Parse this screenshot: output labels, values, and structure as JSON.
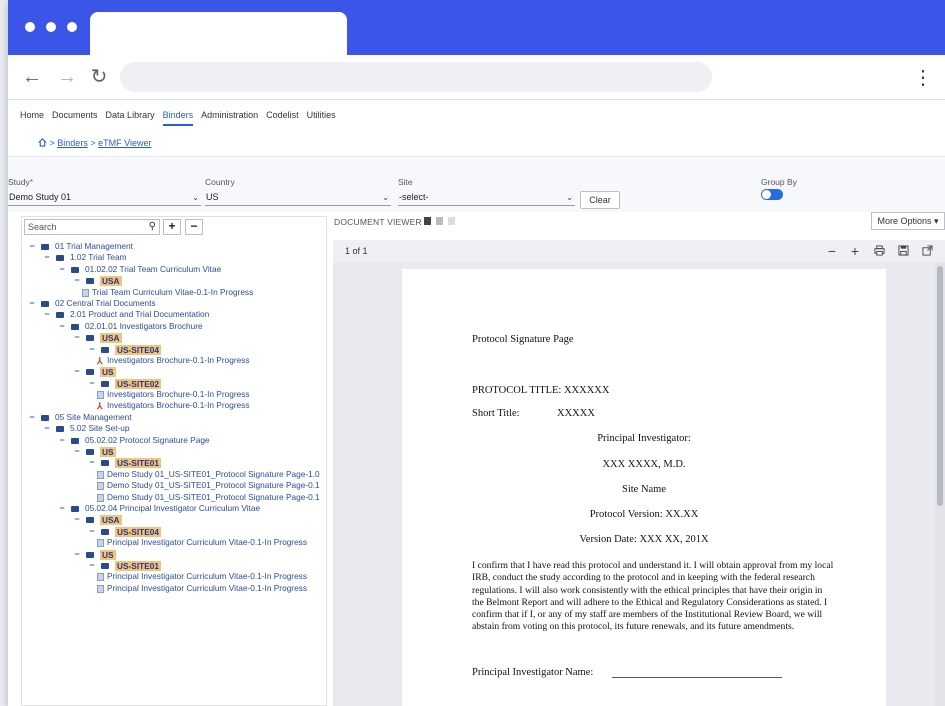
{
  "app": {
    "menu": [
      "Home",
      "Documents",
      "Data Library",
      "Binders",
      "Administration",
      "Codelist",
      "Utilities"
    ],
    "active_menu": "Binders",
    "breadcrumb": {
      "home_icon": "home-icon",
      "sep1": ">",
      "binders": "Binders",
      "sep2": ">",
      "current": "eTMF Viewer"
    }
  },
  "filters": {
    "study": {
      "label": "Study",
      "required_mark": "*",
      "value": "Demo Study 01"
    },
    "country": {
      "label": "Country",
      "value": "US"
    },
    "site": {
      "label": "Site",
      "value": "-select-"
    },
    "clear_label": "Clear",
    "group_by": {
      "label": "Group By",
      "enabled": true
    }
  },
  "tree_panel": {
    "search_placeholder": "Search",
    "add_label": "+",
    "collapse_label": "−",
    "rows": [
      {
        "indent": 0,
        "type": "folder",
        "toggle": "−",
        "label": "01 Trial Management"
      },
      {
        "indent": 1,
        "type": "folder",
        "toggle": "−",
        "label": "1.02 Trial Team"
      },
      {
        "indent": 2,
        "type": "folder",
        "toggle": "−",
        "label": "01.02.02 Trial Team Curriculum Vitae"
      },
      {
        "indent": 3,
        "type": "country",
        "toggle": "−",
        "label": "USA"
      },
      {
        "indent": 4,
        "type": "doc",
        "label": "Trial Team Curriculum Vitae-0.1-In Progress"
      },
      {
        "indent": 0,
        "type": "folder",
        "toggle": "−",
        "label": "02 Central Trial Documents"
      },
      {
        "indent": 1,
        "type": "folder",
        "toggle": "−",
        "label": "2.01 Product and Trial Documentation"
      },
      {
        "indent": 2,
        "type": "folder",
        "toggle": "−",
        "label": "02.01.01 Investigators Brochure"
      },
      {
        "indent": 3,
        "type": "country",
        "toggle": "−",
        "label": "USA"
      },
      {
        "indent": 4,
        "type": "country",
        "toggle": "−",
        "label": "US-SITE04"
      },
      {
        "indent": 5,
        "type": "pdf",
        "label": "Investigators Brochure-0.1-In Progress"
      },
      {
        "indent": 3,
        "type": "country",
        "toggle": "−",
        "label": "US"
      },
      {
        "indent": 4,
        "type": "country",
        "toggle": "−",
        "label": "US-SITE02"
      },
      {
        "indent": 5,
        "type": "doc",
        "label": "Investigators Brochure-0.1-In Progress"
      },
      {
        "indent": 5,
        "type": "pdf",
        "label": "Investigators Brochure-0.1-In Progress"
      },
      {
        "indent": 0,
        "type": "folder",
        "toggle": "−",
        "label": "05 Site Management"
      },
      {
        "indent": 1,
        "type": "folder",
        "toggle": "−",
        "label": "5.02 Site Set-up"
      },
      {
        "indent": 2,
        "type": "folder",
        "toggle": "−",
        "label": "05.02.02 Protocol Signature Page"
      },
      {
        "indent": 3,
        "type": "country",
        "toggle": "−",
        "label": "US"
      },
      {
        "indent": 4,
        "type": "country",
        "toggle": "−",
        "label": "US-SITE01"
      },
      {
        "indent": 5,
        "type": "doc",
        "label": "Demo Study 01_US-SITE01_Protocol Signature Page-1.0"
      },
      {
        "indent": 5,
        "type": "doc",
        "label": "Demo Study 01_US-SITE01_Protocol Signature Page-0.1"
      },
      {
        "indent": 5,
        "type": "doc",
        "label": "Demo Study 01_US-SITE01_Protocol Signature Page-0.1"
      },
      {
        "indent": 2,
        "type": "folder",
        "toggle": "−",
        "label": "05.02.04 Principal Investigator Curriculum Vitae"
      },
      {
        "indent": 3,
        "type": "country",
        "toggle": "−",
        "label": "USA"
      },
      {
        "indent": 4,
        "type": "country",
        "toggle": "−",
        "label": "US-SITE04"
      },
      {
        "indent": 5,
        "type": "doc",
        "label": "Principal Investigator Curriculum Vitae-0.1-In Progress"
      },
      {
        "indent": 3,
        "type": "country",
        "toggle": "−",
        "label": "US"
      },
      {
        "indent": 4,
        "type": "country",
        "toggle": "−",
        "label": "US-SITE01"
      },
      {
        "indent": 5,
        "type": "doc",
        "label": "Principal Investigator Curriculum Vitae-0.1-In Progress"
      },
      {
        "indent": 5,
        "type": "doc",
        "label": "Principal Investigator Curriculum Vitae-0.1-In Progress"
      }
    ]
  },
  "viewer": {
    "title": "DOCUMENT VIEWER",
    "more_options": "More Options ▾",
    "page_count": "1 of 1",
    "tools": {
      "zoom_out": "−",
      "zoom_in": "+",
      "print": "print-icon",
      "save": "save-icon",
      "open": "open-external-icon"
    },
    "document": {
      "heading": "Protocol Signature Page",
      "protocol_title": "PROTOCOL TITLE:  XXXXXX",
      "short_title_label": "Short Title:",
      "short_title_value": "XXXXX",
      "pi_label": "Principal Investigator:",
      "pi_name": "XXX XXXX, M.D.",
      "site_name": "Site Name",
      "protocol_version": "Protocol Version: XX.XX",
      "version_date": "Version Date: XXX  XX, 201X",
      "paragraph": "I confirm that I have read this protocol and understand it. I will obtain approval from my local IRB, conduct the study according to the protocol and in keeping with the federal research regulations. I will also work consistently with the ethical principles that have their origin in the Belmont Report and will adhere to the Ethical and Regulatory Considerations as stated. I confirm that if I, or any of my staff are members of the Institutional Review Board, we will abstain from voting on this protocol, its future renewals, and its future amendments.",
      "pi_name_label": "Principal Investigator Name:"
    }
  },
  "colors": {
    "brand": "#3a55e8",
    "link": "#2a5bd7",
    "highlight": "#f4c27a",
    "folder": "#2b4a8c"
  }
}
